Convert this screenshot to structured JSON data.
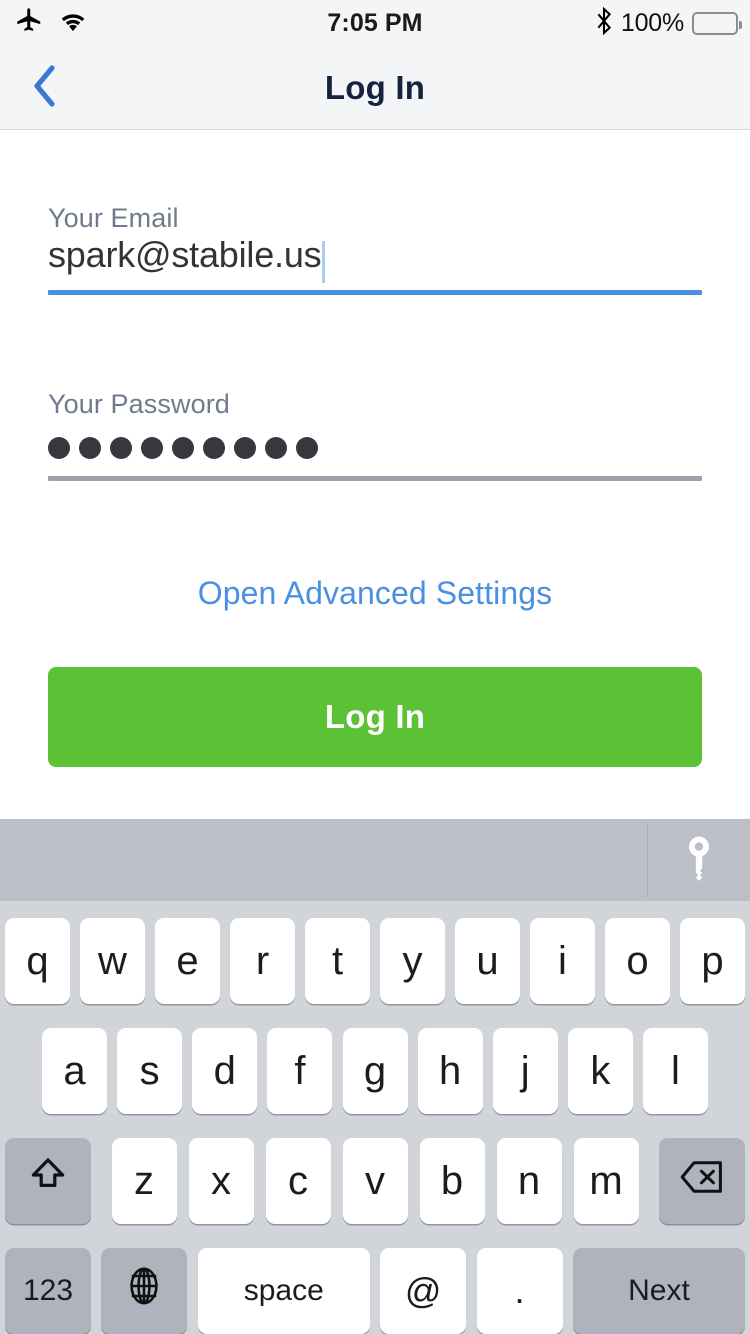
{
  "status_bar": {
    "airplane_icon": "airplane-mode-icon",
    "wifi_icon": "wifi-icon",
    "time": "7:05 PM",
    "bluetooth_icon": "bluetooth-icon",
    "battery_percent": "100%",
    "battery_icon": "battery-full-icon"
  },
  "nav": {
    "back_icon": "chevron-left-icon",
    "title": "Log In"
  },
  "form": {
    "email": {
      "label": "Your Email",
      "value": "spark@stabile.us",
      "placeholder": "Your Email",
      "focused": true,
      "underline_color": "#4a90e2"
    },
    "password": {
      "label": "Your Password",
      "value": "•••••••••",
      "masked_char_count": 9,
      "placeholder": "Your Password",
      "focused": false,
      "underline_color": "#9ba2aa"
    },
    "advanced_link": "Open Advanced Settings",
    "submit_label": "Log In",
    "submit_color": "#5bc236",
    "link_color": "#4a90e2"
  },
  "keyboard": {
    "toolbar": {
      "password_key_icon": "key-icon"
    },
    "row1": [
      "q",
      "w",
      "e",
      "r",
      "t",
      "y",
      "u",
      "i",
      "o",
      "p"
    ],
    "row2": [
      "a",
      "s",
      "d",
      "f",
      "g",
      "h",
      "j",
      "k",
      "l"
    ],
    "row3": {
      "shift_icon": "shift-arrow-icon",
      "letters": [
        "z",
        "x",
        "c",
        "v",
        "b",
        "n",
        "m"
      ],
      "backspace_icon": "backspace-delete-icon"
    },
    "row4": {
      "numeric_label": "123",
      "globe_icon": "globe-language-icon",
      "space_label": "space",
      "at_label": "@",
      "period_label": ".",
      "return_label": "Next"
    }
  }
}
